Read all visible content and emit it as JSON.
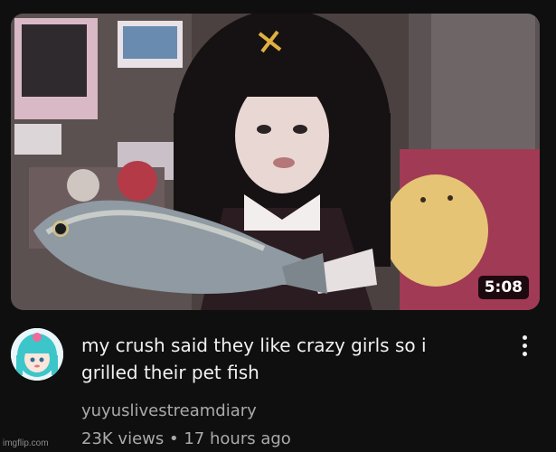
{
  "video": {
    "duration": "5:08",
    "title": "my crush said they like crazy girls so i grilled their pet fish",
    "channel": "yuyuslivestreamdiary",
    "views": "23K views",
    "separator": "•",
    "age": "17 hours ago"
  },
  "watermark": "imgflip.com",
  "icons": {
    "menu": "vertical-ellipsis-icon",
    "avatar": "channel-avatar-anime-girl"
  },
  "colors": {
    "background": "#0f0f0f",
    "title_text": "#f1f1f1",
    "secondary_text": "#aaaaaa",
    "duration_badge": "#000000"
  }
}
